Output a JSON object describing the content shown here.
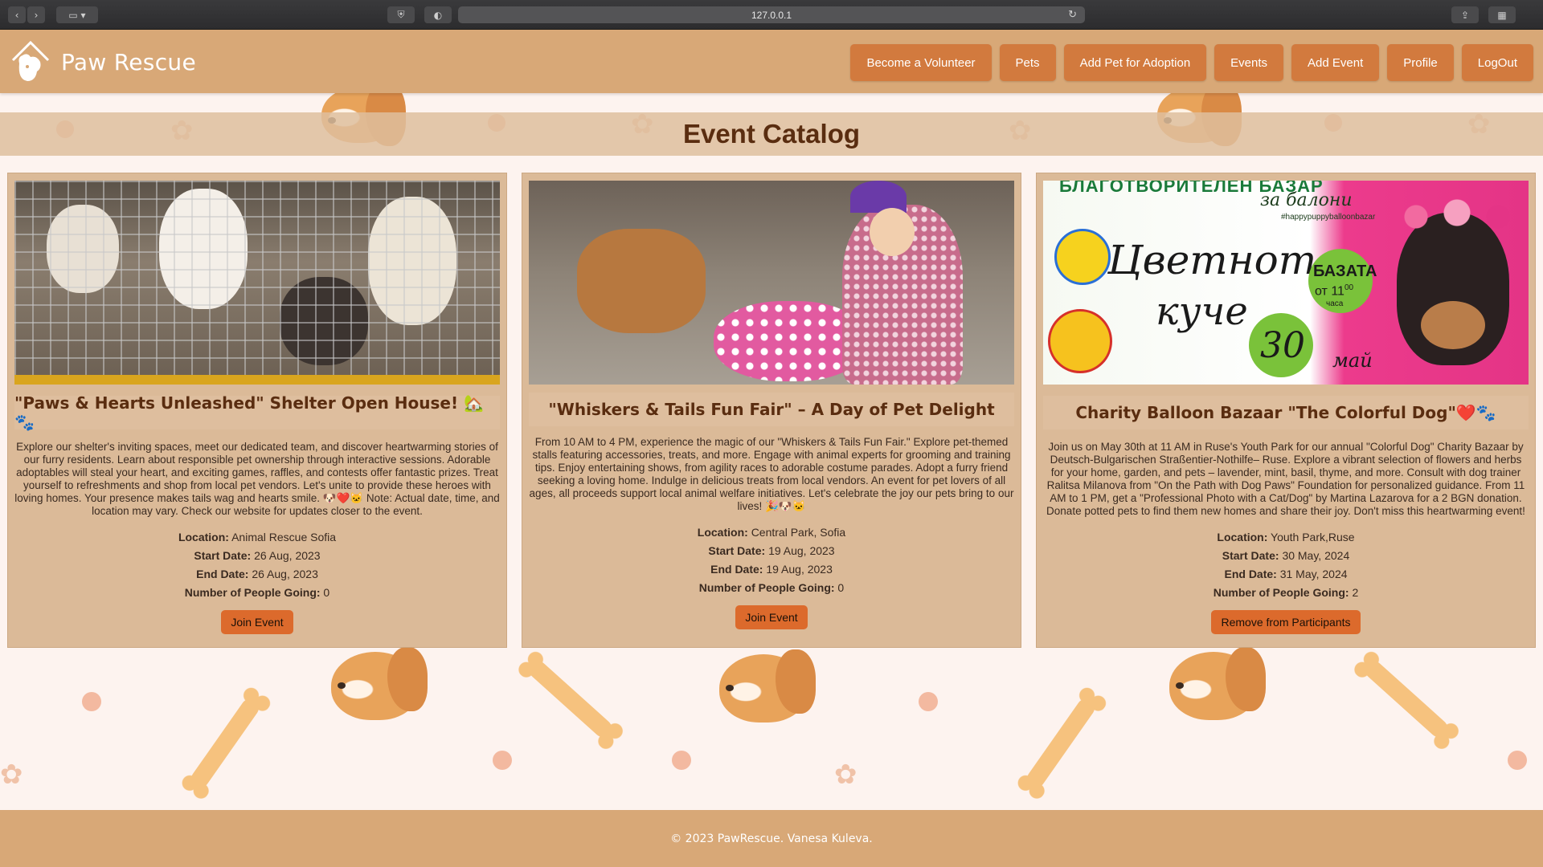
{
  "browser": {
    "url": "127.0.0.1"
  },
  "brand": {
    "name": "Paw Rescue"
  },
  "nav": [
    {
      "label": "Become a Volunteer"
    },
    {
      "label": "Pets"
    },
    {
      "label": "Add Pet for Adoption"
    },
    {
      "label": "Events"
    },
    {
      "label": "Add Event"
    },
    {
      "label": "Profile"
    },
    {
      "label": "LogOut"
    }
  ],
  "catalog": {
    "title": "Event Catalog"
  },
  "labels": {
    "location": "Location:",
    "start_date": "Start Date:",
    "end_date": "End Date:",
    "going": "Number of People Going:"
  },
  "events": [
    {
      "title": "\"Paws & Hearts Unleashed\" Shelter Open House! 🏡🐾",
      "description": "Explore our shelter's inviting spaces, meet our dedicated team, and discover heartwarming stories of our furry residents. Learn about responsible pet ownership through interactive sessions. Adorable adoptables will steal your heart, and exciting games, raffles, and contests offer fantastic prizes. Treat yourself to refreshments and shop from local pet vendors. Let's unite to provide these heroes with loving homes. Your presence makes tails wag and hearts smile. 🐶❤️🐱 Note: Actual date, time, and location may vary. Check our website for updates closer to the event.",
      "location": "Animal Rescue Sofia",
      "start_date": "26 Aug, 2023",
      "end_date": "26 Aug, 2023",
      "going": "0",
      "button": "Join Event"
    },
    {
      "title": "\"Whiskers & Tails Fun Fair\" – A Day of Pet Delight",
      "description": "From 10 AM to 4 PM, experience the magic of our \"Whiskers & Tails Fun Fair.\" Explore pet-themed stalls featuring accessories, treats, and more. Engage with animal experts for grooming and training tips. Enjoy entertaining shows, from agility races to adorable costume parades. Adopt a furry friend seeking a loving home. Indulge in delicious treats from local vendors. An event for pet lovers of all ages, all proceeds support local animal welfare initiatives. Let's celebrate the joy our pets bring to our lives! 🎉🐶🐱",
      "location": "Central Park, Sofia",
      "start_date": "19 Aug, 2023",
      "end_date": "19 Aug, 2023",
      "going": "0",
      "button": "Join Event"
    },
    {
      "title": "Charity Balloon Bazaar \"The Colorful Dog\"❤️🐾",
      "description": "Join us on May 30th at 11 AM in Ruse's Youth Park for our annual \"Colorful Dog\" Charity Bazaar by Deutsch-Bulgarischen Straßentier-Nothilfe– Ruse. Explore a vibrant selection of flowers and herbs for your home, garden, and pets – lavender, mint, basil, thyme, and more. Consult with dog trainer Ralitsa Milanova from \"On the Path with Dog Paws\" Foundation for personalized guidance. From 11 AM to 1 PM, get a \"Professional Photo with a Cat/Dog\" by Martina Lazarova for a 2 BGN donation. Donate potted pets to find them new homes and share their joy. Don't miss this heartwarming event!",
      "location": "Youth Park,Ruse",
      "start_date": "30 May, 2024",
      "end_date": "31 May, 2024",
      "going": "2",
      "button": "Remove from Participants",
      "poster_text": {
        "top": "БЛАГОТВОРИТЕЛЕН БАЗАР",
        "sub": "за балони",
        "hashtag": "#happypuppyballoonbazar",
        "main1": "Цветното",
        "main2": "куче",
        "bazaar": "БАЗАТА",
        "time_prefix": "от",
        "time": "11",
        "time_sup": "00",
        "time_unit": "часа",
        "day": "30",
        "month": "май"
      }
    }
  ],
  "footer": {
    "text": "© 2023 PawRescue. Vanesa Kuleva."
  }
}
